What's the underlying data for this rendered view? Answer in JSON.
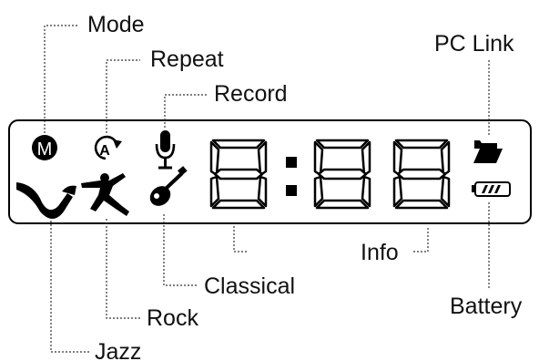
{
  "labels": {
    "mode": "Mode",
    "repeat": "Repeat",
    "record": "Record",
    "pc_link": "PC Link",
    "info": "Info",
    "battery": "Battery",
    "classical": "Classical",
    "rock": "Rock",
    "jazz": "Jazz"
  },
  "icons": {
    "mode_letter": "M",
    "repeat_letter": "A",
    "names": [
      "mode-icon",
      "repeat-icon",
      "microphone-icon",
      "jazz-saxophone-icon",
      "rock-dancer-icon",
      "guitar-icon",
      "folder-icon",
      "battery-icon"
    ]
  },
  "display": {
    "digits": [
      "8",
      "8",
      "8"
    ],
    "separator": ":"
  },
  "colors": {
    "ink": "#000000",
    "background": "#ffffff"
  }
}
